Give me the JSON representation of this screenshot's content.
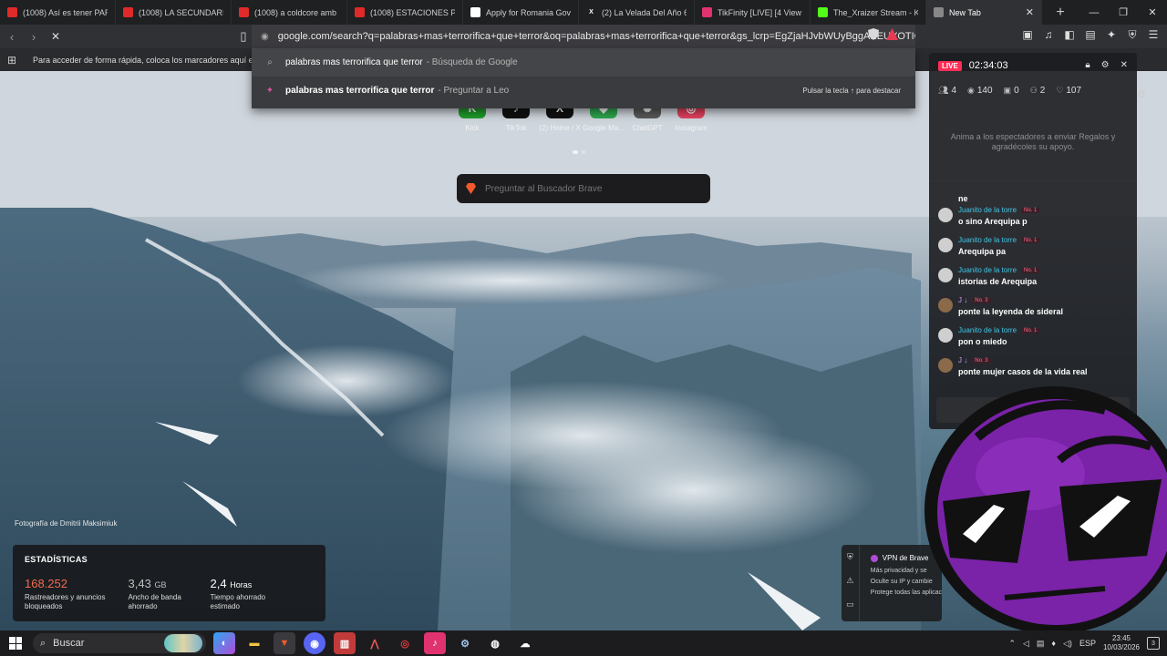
{
  "tabs": [
    {
      "title": "(1008) Así es tener PAREJA",
      "icon": "youtube-icon",
      "color": "#e02a2a"
    },
    {
      "title": "(1008) LA SECUNDARIA ES",
      "icon": "youtube-icon",
      "color": "#e02a2a"
    },
    {
      "title": "(1008) a coldcore amb",
      "icon": "youtube-icon",
      "color": "#e02a2a"
    },
    {
      "title": "(1008) ESTACIONES Param",
      "icon": "youtube-icon",
      "color": "#e02a2a"
    },
    {
      "title": "Apply for Romania Govern",
      "icon": "google-icon",
      "color": "#ffffff"
    },
    {
      "title": "(2) La Velada Del Año 6 (@",
      "icon": "x-icon",
      "color": "#000000"
    },
    {
      "title": "TikFinity [LIVE] [4 View",
      "icon": "tikfinity-icon",
      "color": "#e0326e"
    },
    {
      "title": "The_Xraizer Stream - Kick",
      "icon": "kick-icon",
      "color": "#53fc18"
    },
    {
      "title": "New Tab",
      "icon": "loading-icon",
      "color": "#888888"
    }
  ],
  "url": "google.com/search?q=palabras+mas+terrorifica+que+terror&oq=palabras+mas+terrorifica+que+terror&gs_lcrp=EgZjaHJvbWUyBggAEEUYOTIGCAEQL...",
  "bookmarks_hint": "Para acceder de forma rápida, coloca los marcadores aquí en la barra",
  "omnibox": {
    "query": "palabras mas terrorifica que terror",
    "row1_suffix": "- Búsqueda de Google",
    "row2_suffix": "- Preguntar a Leo",
    "hint": "Pulsar la tecla ↑ para destacar"
  },
  "shortcuts": [
    {
      "label": "Kick",
      "icon": "kick-icon",
      "color": "#1f9d2a",
      "glyph": "K"
    },
    {
      "label": "TikTok",
      "icon": "tiktok-icon",
      "color": "#111111",
      "glyph": "♪"
    },
    {
      "label": "(2) Home / X",
      "icon": "x-icon",
      "color": "#111111",
      "glyph": "X"
    },
    {
      "label": "Google Ma...",
      "icon": "maps-icon",
      "color": "#2fa84f",
      "glyph": "◆"
    },
    {
      "label": "ChatGPT",
      "icon": "chatgpt-icon",
      "color": "#5a5a5a",
      "glyph": "✺"
    },
    {
      "label": "Instagram",
      "icon": "instagram-icon",
      "color": "#e4405f",
      "glyph": "◎"
    }
  ],
  "brave_search": {
    "placeholder": "Preguntar al Buscador Brave"
  },
  "photo_credit": "Fotografía de Dmitrii Maksimiuk",
  "stats": {
    "title": "ESTADÍSTICAS",
    "blocked_value": "168.252",
    "blocked_label": "Rastreadores y anuncios bloqueados",
    "bandwidth_value": "3,43",
    "bandwidth_unit": "GB",
    "bandwidth_label": "Ancho de banda ahorrado",
    "time_value": "2,4",
    "time_unit": "Horas",
    "time_label": "Tiempo ahorrado estimado"
  },
  "vpn": {
    "title": "VPN de Brave",
    "items": [
      "Más privacidad y se",
      "Oculte su IP y cambie",
      "Protege todas las aplicac"
    ]
  },
  "live": {
    "badge": "LIVE",
    "timer": "02:34:03",
    "counts": {
      "viewers_a": "4",
      "views": "140",
      "gifts": "0",
      "shares": "2",
      "likes": "107"
    },
    "encourage": "Anima a los espectadores a enviar Regalos y agradécoles su apoyo.",
    "fragment": "ne",
    "messages": [
      {
        "user": "Juanito de la torre",
        "rank": "No. 1",
        "text": "o sino Arequipa p"
      },
      {
        "user": "Juanito de la torre",
        "rank": "No. 1",
        "text": "Arequipa pa"
      },
      {
        "user": "Juanito de la torre",
        "rank": "No. 1",
        "text": "istorias de Arequipa"
      },
      {
        "user": "J ↓",
        "rank": "No. 3",
        "text": "ponte la leyenda de sideral"
      },
      {
        "user": "Juanito de la torre",
        "rank": "No. 1",
        "text": "pon o miedo"
      },
      {
        "user": "J ↓",
        "rank": "No. 3",
        "text": "ponte mujer casos de la vida real"
      }
    ]
  },
  "taskbar": {
    "search": "Buscar",
    "lang": "ESP",
    "time": "23:45",
    "date": "10/03/2026",
    "notifications": "3"
  }
}
